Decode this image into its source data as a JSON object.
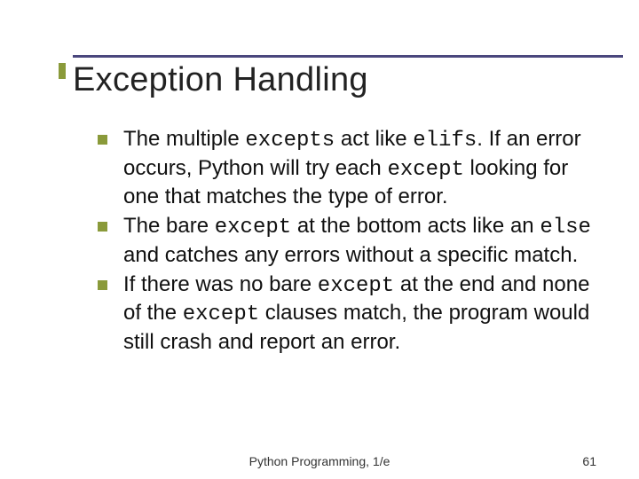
{
  "title": "Exception Handling",
  "bullets": [
    {
      "parts": [
        "The multiple ",
        "excepts",
        " act like ",
        "elifs",
        ". If an error occurs, Python will try each ",
        "except",
        " looking for one that matches the type of error."
      ]
    },
    {
      "parts": [
        "The bare ",
        "except",
        " at the bottom acts like an ",
        "else",
        " and catches any errors without a specific match."
      ]
    },
    {
      "parts": [
        "If there was no bare ",
        "except",
        " at the end and none of the ",
        "except",
        " clauses match, the program would still crash and report an error."
      ]
    }
  ],
  "footer": {
    "source": "Python Programming, 1/e",
    "page": "61"
  },
  "colors": {
    "rule": "#4a477d",
    "accent": "#8a9a3a"
  }
}
